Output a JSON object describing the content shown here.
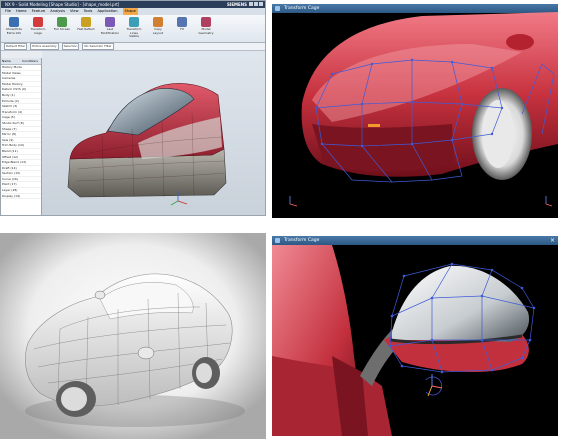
{
  "panel_nx": {
    "title": "NX 9 - Solid Modeling [Shape Studio] - [shape_model.prt]",
    "brand": "SIEMENS",
    "menus": [
      "File",
      "Home",
      "Feature",
      "Analysis",
      "View",
      "Tools",
      "Application",
      "Shape"
    ],
    "active_menu_index": 7,
    "ribbon_buttons": [
      {
        "label": "Show/Hide Extra Info",
        "color": "#3a6fb0"
      },
      {
        "label": "Transform Cage",
        "color": "#d23c3c"
      },
      {
        "label": "Full Screen",
        "color": "#4b9b4b"
      },
      {
        "label": "Fast Reflect",
        "color": "#c9a020"
      },
      {
        "label": "Last Modification",
        "color": "#7a5ab5"
      },
      {
        "label": "Transform Lines Visible",
        "color": "#3c9fb8"
      },
      {
        "label": "Copy Layout",
        "color": "#d08030"
      },
      {
        "label": "Fit",
        "color": "#5575b0"
      },
      {
        "label": "Model Geometry",
        "color": "#b04060"
      }
    ],
    "combos": [
      "Default Filter",
      "Entire Assembly",
      "Selection",
      "No Selection Filter"
    ],
    "nav_header": [
      "Name",
      "Conditions"
    ],
    "nav_rows": [
      "History Mode",
      "Model Views",
      "Cameras",
      "Model History",
      "Datum CSYS (0)",
      "Body (1)",
      "Extrude (2)",
      "Sketch (3)",
      "Transform (4)",
      "Cage (5)",
      "Studio Surf (6)",
      "Shape (7)",
      "Mirror (8)",
      "Sew (9)",
      "Trim Body (10)",
      "Blend (11)",
      "Offset (12)",
      "Edge Blend (13)",
      "Draft (14)",
      "Section (15)",
      "Curve (16)",
      "Point (17)",
      "Layer (18)",
      "Display (19)"
    ]
  },
  "panel_cage_front": {
    "caption": "Transform Cage",
    "close_label": "×"
  },
  "panel_cage_mirror": {
    "caption": "Transform Cage",
    "close_label": "×"
  }
}
